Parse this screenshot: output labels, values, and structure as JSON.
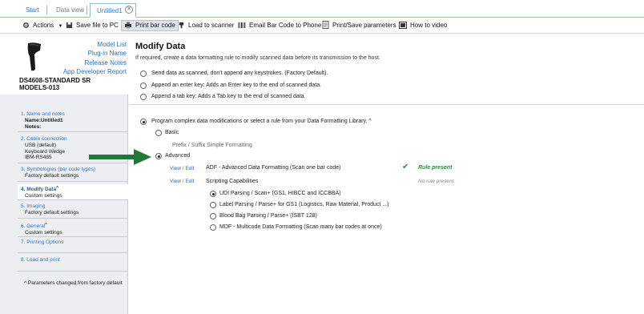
{
  "tabs": {
    "start": "Start",
    "data_view": "Data view",
    "active": "Untitled1",
    "close_glyph": "✕"
  },
  "toolbar": {
    "actions": "Actions",
    "save": "Save file to PC",
    "print": "Print bar code",
    "load": "Load to scanner",
    "email": "Email Bar Code to Phone",
    "params": "Print/Save parameters",
    "video": "How to video"
  },
  "device": {
    "links": [
      "Model List",
      "Plug-in Name",
      "Release Notes",
      "App Developer Report"
    ],
    "name_line1": "DS4608-STANDARD SR",
    "name_line2": "MODELS-013"
  },
  "steps": [
    {
      "title": "1.  Name and notes",
      "lines": [
        "Name:Untitled1",
        "Notes:"
      ]
    },
    {
      "title": "2.  Cable connection",
      "lines": [
        "USB (default)",
        "Keyboard Wedge",
        "IBM-RS485"
      ]
    },
    {
      "title": "3.  Symbologies (bar code types)",
      "lines": [
        "Factory default settings"
      ]
    },
    {
      "title": "4.  Modify Data",
      "mark": "^",
      "lines": [
        "Custom settings"
      ]
    },
    {
      "title": "5.  Imaging",
      "lines": [
        "Factory default settings"
      ]
    },
    {
      "title": "6.  General",
      "mark": "^",
      "lines": [
        "Custom settings"
      ]
    },
    {
      "title": "7.  Printing Options",
      "lines": []
    },
    {
      "title": "8.  Load and print",
      "lines": []
    }
  ],
  "footnote": "^  Parameters changed from factory default",
  "main": {
    "heading": "Modify Data",
    "hint": "If required, create a data formatting rule to modify scanned data before its transmission to the host.",
    "options": [
      "Send data as scanned, don't append any keystrokes. (Factory Default).",
      "Append an enter key: Adds an Enter key to the end of scanned data.",
      "Append a tab key: Adds a Tab key to the end of scanned data."
    ],
    "complex": "Program complex data modifications or select a rule from your Data Formatting Library.  ^",
    "basic": "Basic",
    "prefix": "Prefix / Suffix Simple Formatting",
    "advanced": "Advanced",
    "view_edit": "View / Edit",
    "adf": "ADF - Advanced Data Formatting (Scan one bar code)",
    "rule_present": "Rule present",
    "scripting": "Scripting Capabilities",
    "no_rule": "No rule present",
    "scripts": [
      "UDI Parsing / Scan+ (GS1, HIBCC and ICCBBA)",
      "Label Parsing / Parse+ for GS1 (Logistics, Raw Material, Product ...)",
      "Blood Bag Parsing / Parse+ (ISBT 128)",
      "MDF - Multicode Data Formatting (Scan many bar codes at once)"
    ]
  },
  "colors": {
    "arrow": "#1f7a3a",
    "link": "#2e6fc0",
    "ok": "#2e8b3a"
  }
}
